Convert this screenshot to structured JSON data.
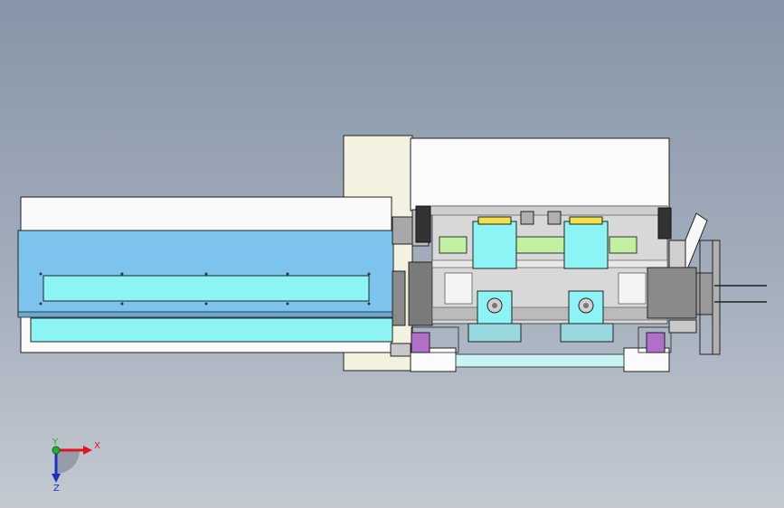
{
  "viewport": {
    "background_top": "#8795a8",
    "background_bottom": "#c4c9d1"
  },
  "triad": {
    "x_label": "X",
    "y_label": "Y",
    "z_label": "Z",
    "x_color": "#e0141e",
    "y_color": "#20b030",
    "z_color": "#1830c8"
  },
  "colors": {
    "panel_white": "#fafafa",
    "panel_cream": "#f3f1e0",
    "light_blue": "#7cc4ee",
    "cyan": "#8cf4f4",
    "dark_gray": "#7a7a7a",
    "magenta": "#b070c8",
    "yellow": "#f2e04a",
    "green": "#c0f0a0",
    "steel": "#a8a8a8"
  }
}
